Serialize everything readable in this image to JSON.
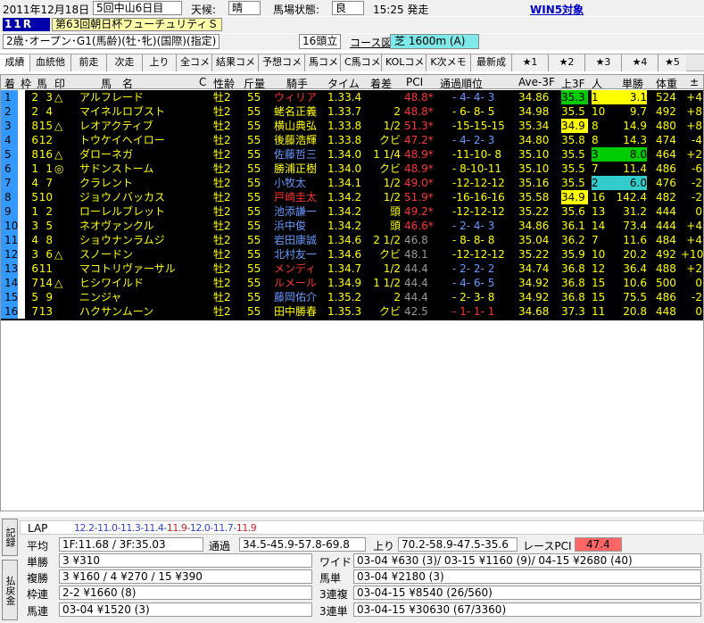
{
  "header": {
    "date": "2011年12月18日",
    "meeting": "5回中山6日目",
    "weather_label": "天候:",
    "weather": "晴",
    "track_label": "馬場状態:",
    "track": "良",
    "post_time": "15:25 発走",
    "win5": "WIN5対象"
  },
  "race": {
    "number": "11R",
    "name": "第63回朝日杯フューチュリティＳ",
    "conditions": "2歳･オープン･G1(馬齢)(牡･牝)(国際)(指定)",
    "heads": "16頭立",
    "course_label": "コース図",
    "course": "芝  1600m (A)"
  },
  "tabs": [
    "成績",
    "血統他",
    "前走",
    "次走",
    "上り",
    "全コメ",
    "結果コメ",
    "予想コメ",
    "馬コメ",
    "C馬コメ",
    "KOLコメ",
    "K次メモ",
    "最新成",
    "★1",
    "★2",
    "★3",
    "★4",
    "★5"
  ],
  "columns": [
    "着",
    "枠",
    "馬",
    "印",
    "馬　名",
    "C",
    "性齢",
    "斤量",
    "騎手",
    "タイム",
    "着差",
    "PCI",
    "通過順位",
    "Ave-3F",
    "上3F",
    "人",
    "単勝",
    "体重",
    "±"
  ],
  "rows": [
    {
      "pos": "1",
      "waku": "2",
      "uma": "3",
      "mark": "△",
      "name": "アルフレード",
      "sex": "牡2",
      "kin": "55",
      "jockey": "ウィリア",
      "jc": "rd",
      "time": "1.33.4",
      "margin": "",
      "pci": "48.8*",
      "pc": "rd",
      "pass": "- 4- 4- 3",
      "pac": "bl",
      "ave": "34.86",
      "f3": "35.3",
      "f3c": "gb",
      "pop": "1",
      "popc": "yb",
      "odds": "3.1",
      "oddsc": "yb",
      "wt": "524",
      "diff": "+4"
    },
    {
      "pos": "2",
      "waku": "2",
      "uma": "4",
      "mark": "",
      "name": "マイネルロブスト",
      "sex": "牡2",
      "kin": "55",
      "jockey": "蛯名正義",
      "jc": "",
      "time": "1.33.7",
      "margin": "2",
      "pci": "48.8*",
      "pc": "rd",
      "pass": "- 6- 8- 5",
      "pac": "",
      "ave": "34.98",
      "f3": "35.5",
      "f3c": "",
      "pop": "10",
      "popc": "",
      "odds": "9.7",
      "oddsc": "",
      "wt": "492",
      "diff": "+8"
    },
    {
      "pos": "3",
      "waku": "8",
      "uma": "15",
      "mark": "△",
      "name": "レオアクティブ",
      "sex": "牡2",
      "kin": "55",
      "jockey": "横山典弘",
      "jc": "",
      "time": "1.33.8",
      "margin": "1/2",
      "pci": "51.3*",
      "pc": "rd",
      "pass": "-15-15-15",
      "pac": "",
      "ave": "35.34",
      "f3": "34.9",
      "f3c": "yb",
      "pop": "8",
      "popc": "",
      "odds": "14.9",
      "oddsc": "",
      "wt": "480",
      "diff": "+8"
    },
    {
      "pos": "4",
      "waku": "6",
      "uma": "12",
      "mark": "",
      "name": "トウケイヘイロー",
      "sex": "牡2",
      "kin": "55",
      "jockey": "後藤浩輝",
      "jc": "",
      "time": "1.33.8",
      "margin": "クビ",
      "pci": "47.2*",
      "pc": "rd",
      "pass": "- 4- 2- 3",
      "pac": "bl",
      "ave": "34.80",
      "f3": "35.8",
      "f3c": "",
      "pop": "8",
      "popc": "",
      "odds": "14.3",
      "oddsc": "",
      "wt": "474",
      "diff": "-4"
    },
    {
      "pos": "5",
      "waku": "8",
      "uma": "16",
      "mark": "△",
      "name": "ダローネガ",
      "sex": "牡2",
      "kin": "55",
      "jockey": "佐藤哲三",
      "jc": "bl",
      "time": "1.34.0",
      "margin": "1 1/4",
      "pci": "48.9*",
      "pc": "rd",
      "pass": "-11-10- 8",
      "pac": "",
      "ave": "35.10",
      "f3": "35.5",
      "f3c": "",
      "pop": "3",
      "popc": "gb",
      "odds": "8.0",
      "oddsc": "gb",
      "wt": "464",
      "diff": "+2"
    },
    {
      "pos": "6",
      "waku": "1",
      "uma": "1",
      "mark": "◎",
      "name": "サドンストーム",
      "sex": "牡2",
      "kin": "55",
      "jockey": "勝浦正樹",
      "jc": "",
      "time": "1.34.0",
      "margin": "クビ",
      "pci": "48.9*",
      "pc": "rd",
      "pass": "- 8-10-11",
      "pac": "",
      "ave": "35.10",
      "f3": "35.5",
      "f3c": "",
      "pop": "7",
      "popc": "",
      "odds": "11.4",
      "oddsc": "",
      "wt": "486",
      "diff": "-6"
    },
    {
      "pos": "7",
      "waku": "4",
      "uma": "7",
      "mark": "",
      "name": "クラレント",
      "sex": "牡2",
      "kin": "55",
      "jockey": "小牧太",
      "jc": "bl",
      "time": "1.34.1",
      "margin": "1/2",
      "pci": "49.0*",
      "pc": "rd",
      "pass": "-12-12-12",
      "pac": "",
      "ave": "35.16",
      "f3": "35.5",
      "f3c": "",
      "pop": "2",
      "popc": "cb",
      "odds": "6.0",
      "oddsc": "cb",
      "wt": "476",
      "diff": "-2"
    },
    {
      "pos": "8",
      "waku": "5",
      "uma": "10",
      "mark": "",
      "name": "ジョウノバッカス",
      "sex": "牡2",
      "kin": "55",
      "jockey": "戸崎圭太",
      "jc": "rd",
      "time": "1.34.2",
      "margin": "1/2",
      "pci": "51.9*",
      "pc": "rd",
      "pass": "-16-16-16",
      "pac": "",
      "ave": "35.58",
      "f3": "34.9",
      "f3c": "yb",
      "pop": "16",
      "popc": "",
      "odds": "142.4",
      "oddsc": "",
      "wt": "482",
      "diff": "-2"
    },
    {
      "pos": "9",
      "waku": "1",
      "uma": "2",
      "mark": "",
      "name": "ローレルブレット",
      "sex": "牡2",
      "kin": "55",
      "jockey": "池添謙一",
      "jc": "bl",
      "time": "1.34.2",
      "margin": "頭",
      "pci": "49.2*",
      "pc": "rd",
      "pass": "-12-12-12",
      "pac": "",
      "ave": "35.22",
      "f3": "35.6",
      "f3c": "",
      "pop": "13",
      "popc": "",
      "odds": "31.2",
      "oddsc": "",
      "wt": "444",
      "diff": "0"
    },
    {
      "pos": "10",
      "waku": "3",
      "uma": "5",
      "mark": "",
      "name": "ネオヴァンクル",
      "sex": "牡2",
      "kin": "55",
      "jockey": "浜中俊",
      "jc": "bl",
      "time": "1.34.2",
      "margin": "頭",
      "pci": "46.6*",
      "pc": "rd",
      "pass": "- 2- 4- 3",
      "pac": "bl",
      "ave": "34.86",
      "f3": "36.1",
      "f3c": "",
      "pop": "14",
      "popc": "",
      "odds": "73.4",
      "oddsc": "",
      "wt": "444",
      "diff": "+4"
    },
    {
      "pos": "11",
      "waku": "4",
      "uma": "8",
      "mark": "",
      "name": "ショウナンラムジ",
      "sex": "牡2",
      "kin": "55",
      "jockey": "岩田康誠",
      "jc": "bl",
      "time": "1.34.6",
      "margin": "2 1/2",
      "pci": "46.8",
      "pc": "gr",
      "pass": "- 8- 8- 8",
      "pac": "",
      "ave": "35.04",
      "f3": "36.2",
      "f3c": "",
      "pop": "7",
      "popc": "",
      "odds": "11.6",
      "oddsc": "",
      "wt": "484",
      "diff": "+4"
    },
    {
      "pos": "12",
      "waku": "3",
      "uma": "6",
      "mark": "△",
      "name": "スノードン",
      "sex": "牡2",
      "kin": "55",
      "jockey": "北村友一",
      "jc": "bl",
      "time": "1.34.6",
      "margin": "クビ",
      "pci": "48.1",
      "pc": "gr",
      "pass": "-12-12-12",
      "pac": "",
      "ave": "35.22",
      "f3": "35.9",
      "f3c": "",
      "pop": "10",
      "popc": "",
      "odds": "20.2",
      "oddsc": "",
      "wt": "492",
      "diff": "+10"
    },
    {
      "pos": "13",
      "waku": "6",
      "uma": "11",
      "mark": "",
      "name": "マコトリヴァーサル",
      "sex": "牡2",
      "kin": "55",
      "jockey": "メンディ",
      "jc": "rd",
      "time": "1.34.7",
      "margin": "1/2",
      "pci": "44.4",
      "pc": "gr",
      "pass": "- 2- 2- 2",
      "pac": "bl",
      "ave": "34.74",
      "f3": "36.8",
      "f3c": "",
      "pop": "12",
      "popc": "",
      "odds": "36.4",
      "oddsc": "",
      "wt": "488",
      "diff": "+2"
    },
    {
      "pos": "14",
      "waku": "7",
      "uma": "14",
      "mark": "△",
      "name": "ヒシワイルド",
      "sex": "牡2",
      "kin": "55",
      "jockey": "ルメール",
      "jc": "rd",
      "time": "1.34.9",
      "margin": "1 1/2",
      "pci": "44.4",
      "pc": "gr",
      "pass": "- 4- 6- 5",
      "pac": "bl",
      "ave": "34.92",
      "f3": "36.8",
      "f3c": "",
      "pop": "15",
      "popc": "",
      "odds": "10.6",
      "oddsc": "",
      "wt": "500",
      "diff": "0"
    },
    {
      "pos": "15",
      "waku": "5",
      "uma": "9",
      "mark": "",
      "name": "ニンジャ",
      "sex": "牡2",
      "kin": "55",
      "jockey": "藤岡佑介",
      "jc": "bl",
      "time": "1.35.2",
      "margin": "2",
      "pci": "44.4",
      "pc": "gr",
      "pass": "- 2- 3- 8",
      "pac": "",
      "ave": "34.92",
      "f3": "36.8",
      "f3c": "",
      "pop": "15",
      "popc": "",
      "odds": "75.5",
      "oddsc": "",
      "wt": "486",
      "diff": "-2"
    },
    {
      "pos": "16",
      "waku": "7",
      "uma": "13",
      "mark": "",
      "name": "ハクサンムーン",
      "sex": "牡2",
      "kin": "55",
      "jockey": "田中勝春",
      "jc": "",
      "time": "1.35.3",
      "margin": "クビ",
      "pci": "42.5",
      "pc": "gr",
      "pass": "- 1- 1- 1",
      "pac": "rd",
      "ave": "34.68",
      "f3": "37.3",
      "f3c": "",
      "pop": "11",
      "popc": "",
      "odds": "20.8",
      "oddsc": "",
      "wt": "448",
      "diff": "0"
    }
  ],
  "result": {
    "side_tab1": "記録",
    "side_tab2": "払戻金",
    "lap_label": "LAP",
    "lap_blue": "12.2-11.0-11.3-11.4-",
    "lap_red1": "11.9",
    "lap_mid": "-12.0-11.7-",
    "lap_red2": "11.9",
    "avg_label": "平均",
    "avg": "1F:11.68 / 3F:35.03",
    "pass_label": "通過",
    "pass": "34.5-45.9-57.8-69.8",
    "agari_label": "上り",
    "agari": "70.2-58.9-47.5-35.6",
    "race_pci_label": "レースPCI",
    "race_pci": "47.4",
    "tansho_label": "単勝",
    "tansho": "3 ¥310",
    "fukusho_label": "複勝",
    "fukusho": "3 ¥160 / 4 ¥270 / 15 ¥390",
    "wakuren_label": "枠連",
    "wakuren": "2-2 ¥1660 (8)",
    "umaren_label": "馬連",
    "umaren": "03-04 ¥1520 (3)",
    "wide_label": "ワイド",
    "wide": "03-04 ¥630 (3)/ 03-15 ¥1160 (9)/ 04-15 ¥2680 (40)",
    "umatan_label": "馬単",
    "umatan": "03-04 ¥2180 (3)",
    "sanrenpuku_label": "3連複",
    "sanrenpuku": "03-04-15 ¥8540 (26/560)",
    "sanrentan_label": "3連単",
    "sanrentan": "03-04-15 ¥30630 (67/3360)"
  },
  "colors": {
    "row_bg": "#000000",
    "num_cell": "#3399ff",
    "race_pci_bg": "#ff6666",
    "course_bg": "#7fe8e8"
  }
}
